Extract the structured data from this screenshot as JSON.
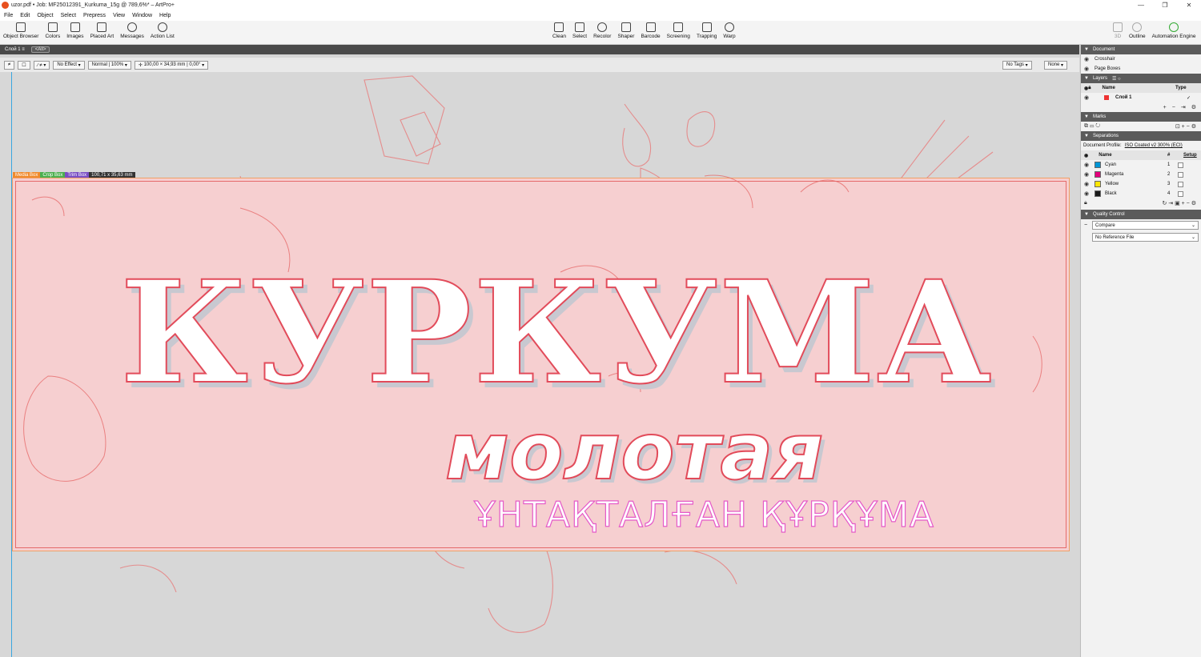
{
  "window": {
    "title": "uzor.pdf • Job: MF25012391_Kurkuma_15g @ 789,6%* – ArtPro+",
    "controls": [
      "—",
      "❐",
      "✕"
    ]
  },
  "menu": [
    "File",
    "Edit",
    "Object",
    "Select",
    "Prepress",
    "View",
    "Window",
    "Help"
  ],
  "toolbar_left": [
    "Object Browser",
    "Colors",
    "Images",
    "Placed Art",
    "Messages",
    "Action List"
  ],
  "toolbar_center": [
    "Clean",
    "Select",
    "Recolor",
    "Shaper",
    "Barcode",
    "Screening",
    "Trapping",
    "Warp"
  ],
  "toolbar_right": [
    "3D",
    "Outline",
    "Automation Engine"
  ],
  "tabstrip": {
    "layer_tab": "Слой 1  ≡",
    "filter_chip": "<All>"
  },
  "options": {
    "effect": "No Effect",
    "blend": "Normal  |  100%",
    "transform": "100,00 × 34,93 mm  |  0,00°",
    "tags": "No Tags",
    "none": "None"
  },
  "boxes": {
    "media": "Media Box",
    "crop": "Crop Box",
    "trim": "Trim Box",
    "dimensions": "100,71 x 35,63 mm"
  },
  "artwork": {
    "title": "КУРКУМА",
    "subtitle": "молотая",
    "kazakh": "ҰНТАҚТАЛҒАН ҚҰРҚҰМА"
  },
  "panel": {
    "document": {
      "header": "Document",
      "items": [
        "Crosshair",
        "Page Boxes"
      ]
    },
    "layers": {
      "header": "Layers",
      "col_name": "Name",
      "col_type": "Type",
      "items": [
        "Слой 1"
      ]
    },
    "marks": {
      "header": "Marks"
    },
    "separations": {
      "header": "Separations",
      "profile_label": "Document Profile:",
      "profile_value": "ISO Coated v2 300% (ECI)",
      "col_name": "Name",
      "col_num": "#",
      "col_setup": "Setup",
      "items": [
        {
          "name": "Cyan",
          "num": "1",
          "color": "#0096d6"
        },
        {
          "name": "Magenta",
          "num": "2",
          "color": "#e4007c"
        },
        {
          "name": "Yellow",
          "num": "3",
          "color": "#ffe600"
        },
        {
          "name": "Black",
          "num": "4",
          "color": "#1a1a1a"
        }
      ]
    },
    "quality": {
      "header": "Quality Control",
      "compare": "Compare",
      "reference": "No Reference File"
    }
  },
  "colors": {
    "accent_stroke": "#e24b5a",
    "art_background": "#f6cfd0",
    "canvas": "#d7d7d7"
  }
}
